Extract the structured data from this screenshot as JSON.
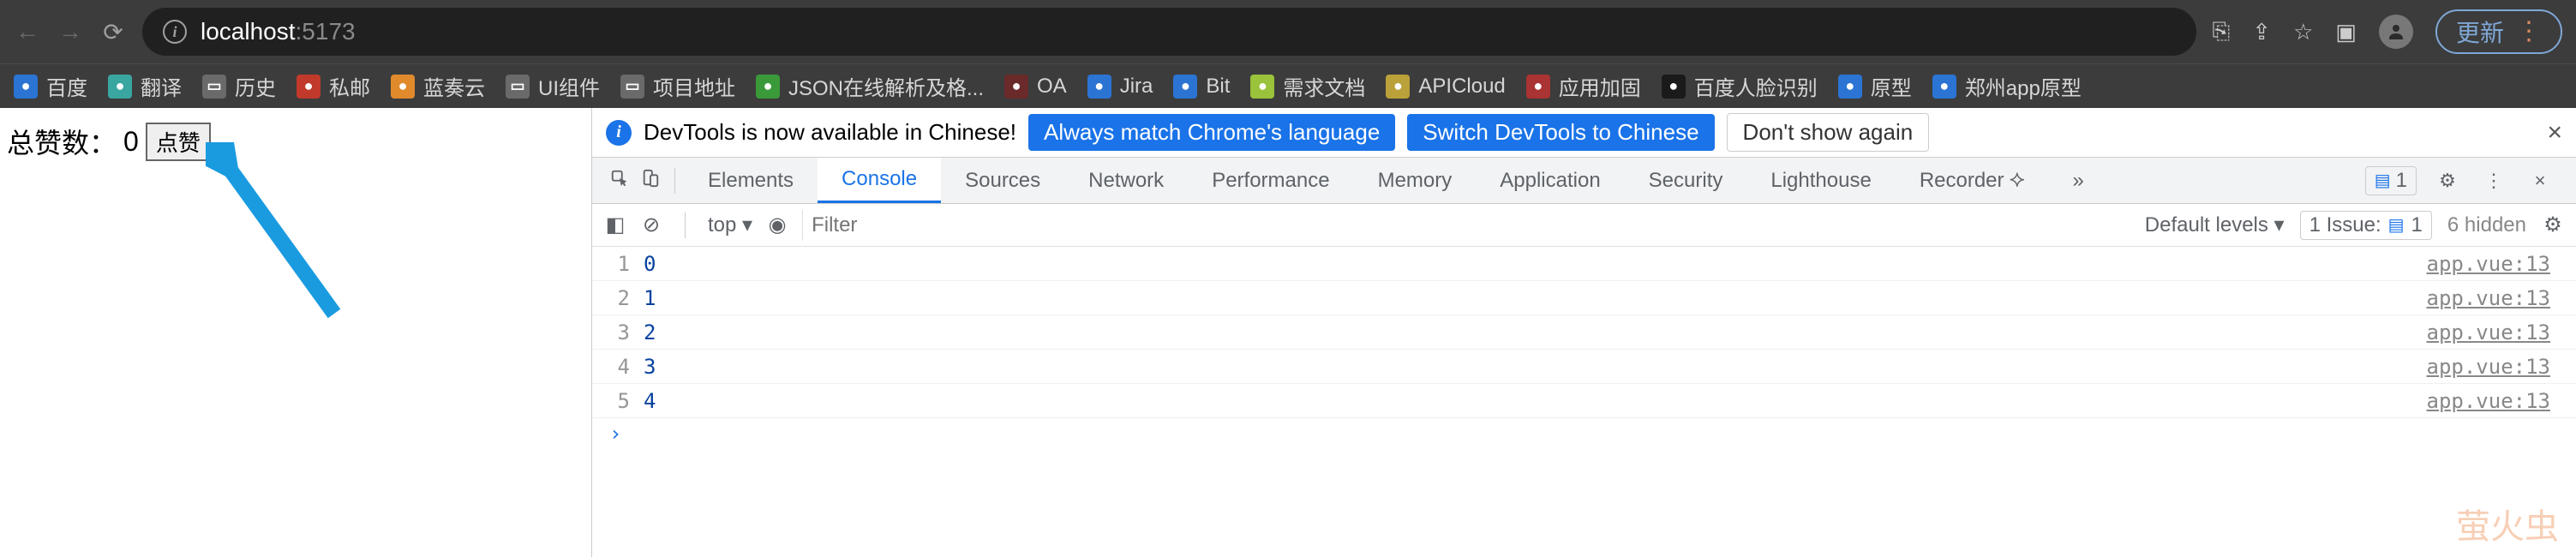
{
  "browser": {
    "url_host": "localhost",
    "url_port": ":5173",
    "update_label": "更新"
  },
  "bookmarks": [
    {
      "label": "百度",
      "cls": "bm-blue"
    },
    {
      "label": "翻译",
      "cls": "bm-teal"
    },
    {
      "label": "历史",
      "cls": "bm-gray"
    },
    {
      "label": "私邮",
      "cls": "bm-red"
    },
    {
      "label": "蓝奏云",
      "cls": "bm-orange"
    },
    {
      "label": "UI组件",
      "cls": "bm-gray"
    },
    {
      "label": "项目地址",
      "cls": "bm-gray"
    },
    {
      "label": "JSON在线解析及格...",
      "cls": "bm-green"
    },
    {
      "label": "OA",
      "cls": "bm-darkred"
    },
    {
      "label": "Jira",
      "cls": "bm-blue"
    },
    {
      "label": "Bit",
      "cls": "bm-blue"
    },
    {
      "label": "需求文档",
      "cls": "bm-lime"
    },
    {
      "label": "APICloud",
      "cls": "bm-gold"
    },
    {
      "label": "应用加固",
      "cls": "bm-red2"
    },
    {
      "label": "百度人脸识别",
      "cls": "bm-black"
    },
    {
      "label": "原型",
      "cls": "bm-blue"
    },
    {
      "label": "郑州app原型",
      "cls": "bm-blue"
    }
  ],
  "page": {
    "like_label": "总赞数：",
    "like_count": "0",
    "like_button": "点赞"
  },
  "devtools": {
    "infobar": {
      "text": "DevTools is now available in Chinese!",
      "always_match": "Always match Chrome's language",
      "switch": "Switch DevTools to Chinese",
      "dont_show": "Don't show again"
    },
    "tabs": [
      "Elements",
      "Console",
      "Sources",
      "Network",
      "Performance",
      "Memory",
      "Application",
      "Security",
      "Lighthouse",
      "Recorder"
    ],
    "active_tab": "Console",
    "recorder_suffix": "⯎",
    "overflow": "»",
    "msg_count": "1",
    "filterbar": {
      "context": "top",
      "filter_placeholder": "Filter",
      "levels": "Default levels",
      "issue_label": "1 Issue:",
      "issue_count": "1",
      "hidden": "6 hidden"
    },
    "logs": [
      {
        "n": "1",
        "v": "0",
        "src": "app.vue:13"
      },
      {
        "n": "2",
        "v": "1",
        "src": "app.vue:13"
      },
      {
        "n": "3",
        "v": "2",
        "src": "app.vue:13"
      },
      {
        "n": "4",
        "v": "3",
        "src": "app.vue:13"
      },
      {
        "n": "5",
        "v": "4",
        "src": "app.vue:13"
      }
    ],
    "prompt": "›"
  },
  "watermark": "萤火虫"
}
